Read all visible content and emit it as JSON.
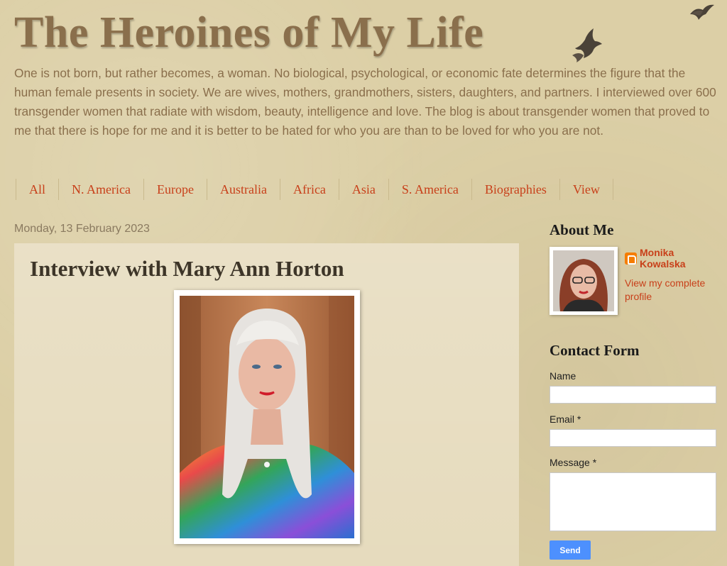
{
  "blog": {
    "title": "The Heroines of My Life",
    "description": "One is not born, but rather becomes, a woman. No biological, psychological, or economic fate determines the figure that the human female presents in society. We are wives, mothers, grandmothers, sisters, daughters, and partners. I interviewed over 600 transgender women that radiate with wisdom, beauty, intelligence and love. The blog is about transgender women that proved to me that there is hope for me and it is better to be hated for who you are than to be loved for who you are not."
  },
  "nav": {
    "items": [
      {
        "label": "All"
      },
      {
        "label": "N. America"
      },
      {
        "label": "Europe"
      },
      {
        "label": "Australia"
      },
      {
        "label": "Africa"
      },
      {
        "label": "Asia"
      },
      {
        "label": "S. America"
      },
      {
        "label": "Biographies"
      },
      {
        "label": "View"
      }
    ]
  },
  "post": {
    "date": "Monday, 13 February 2023",
    "title": "Interview with Mary Ann Horton"
  },
  "sidebar": {
    "about_title": "About Me",
    "profile_name": "Monika Kowalska",
    "profile_link": "View my complete profile",
    "contact_title": "Contact Form",
    "name_label": "Name",
    "email_label": "Email *",
    "message_label": "Message *",
    "send_label": "Send"
  },
  "colors": {
    "background": "#dccfa6",
    "title": "#8a6f4c",
    "link_accent": "#c8401a",
    "send_button": "#4d90fe"
  },
  "icons": [
    "bird-silhouette-icon",
    "blogger-icon"
  ]
}
